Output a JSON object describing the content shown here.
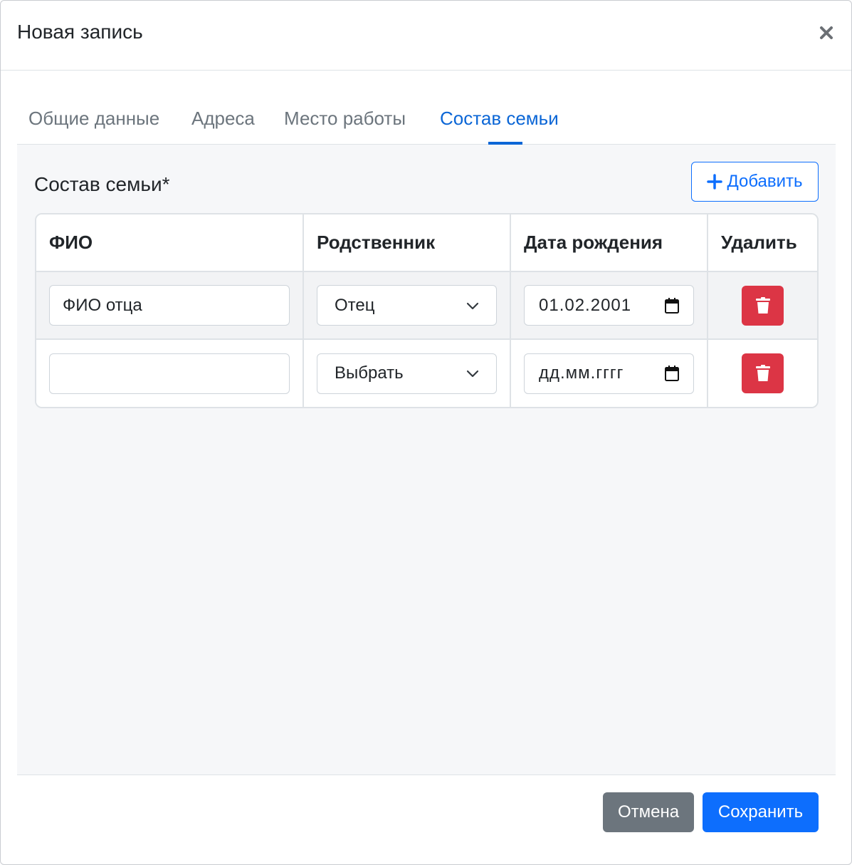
{
  "dialog": {
    "title": "Новая запись",
    "close_icon": "close-icon"
  },
  "tabs": [
    {
      "label": "Общие данные",
      "active": false
    },
    {
      "label": "Адреса",
      "active": false
    },
    {
      "label": "Место работы",
      "active": false
    },
    {
      "label": "Состав семьи",
      "active": true
    }
  ],
  "section": {
    "title": "Состав семьи*",
    "add_button_label": "Добавить",
    "add_icon": "plus-icon"
  },
  "table": {
    "headers": [
      "ФИО",
      "Родственник",
      "Дата рождения",
      "Удалить"
    ],
    "rows": [
      {
        "fio": "ФИО отца",
        "relative": "Отец",
        "birth_date": "01.02.2001",
        "delete_icon": "trash-icon"
      },
      {
        "fio": "",
        "relative": "Выбрать",
        "birth_date": "дд.мм.гггг",
        "delete_icon": "trash-icon"
      }
    ]
  },
  "footer": {
    "cancel_label": "Отмена",
    "save_label": "Сохранить"
  },
  "colors": {
    "primary": "#0d6efd",
    "active_tab": "#0b66d6",
    "danger": "#dc3545",
    "secondary": "#6c757d"
  }
}
